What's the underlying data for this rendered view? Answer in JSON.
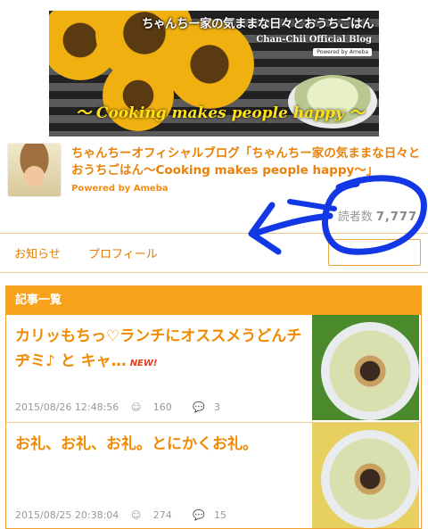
{
  "banner": {
    "title": "ちゃんちー家の気ままな日々とおうちごはん",
    "subtitle": "Chan-Chii Official Blog",
    "powered": "Powered by Ameba",
    "tagline": "〜 Cooking makes people happy 〜"
  },
  "profile": {
    "blog_title": "ちゃんちーオフィシャルブログ「ちゃんちー家の気ままな日々とおうちごはん〜Cooking makes people happy〜」",
    "powered_by": "Powered by Ameba",
    "reader_label": "読者数",
    "reader_count": "7,777"
  },
  "nav": {
    "news": "お知らせ",
    "profile": "プロフィール"
  },
  "articles": {
    "header": "記事一覧",
    "items": [
      {
        "title": "カリッもちっ♡ランチにオススメうどんチヂミ♪ と キャ…",
        "badge": "NEW!",
        "date": "2015/08/26 12:48:56",
        "likes": "160",
        "comments": "3"
      },
      {
        "title": "お礼、お礼、お礼。とにかくお礼。",
        "date": "2015/08/25 20:38:04",
        "likes": "274",
        "comments": "15"
      }
    ]
  },
  "colors": {
    "accent": "#f7a21b",
    "title_orange": "#f08a00",
    "annotation_blue": "#1238e6"
  }
}
